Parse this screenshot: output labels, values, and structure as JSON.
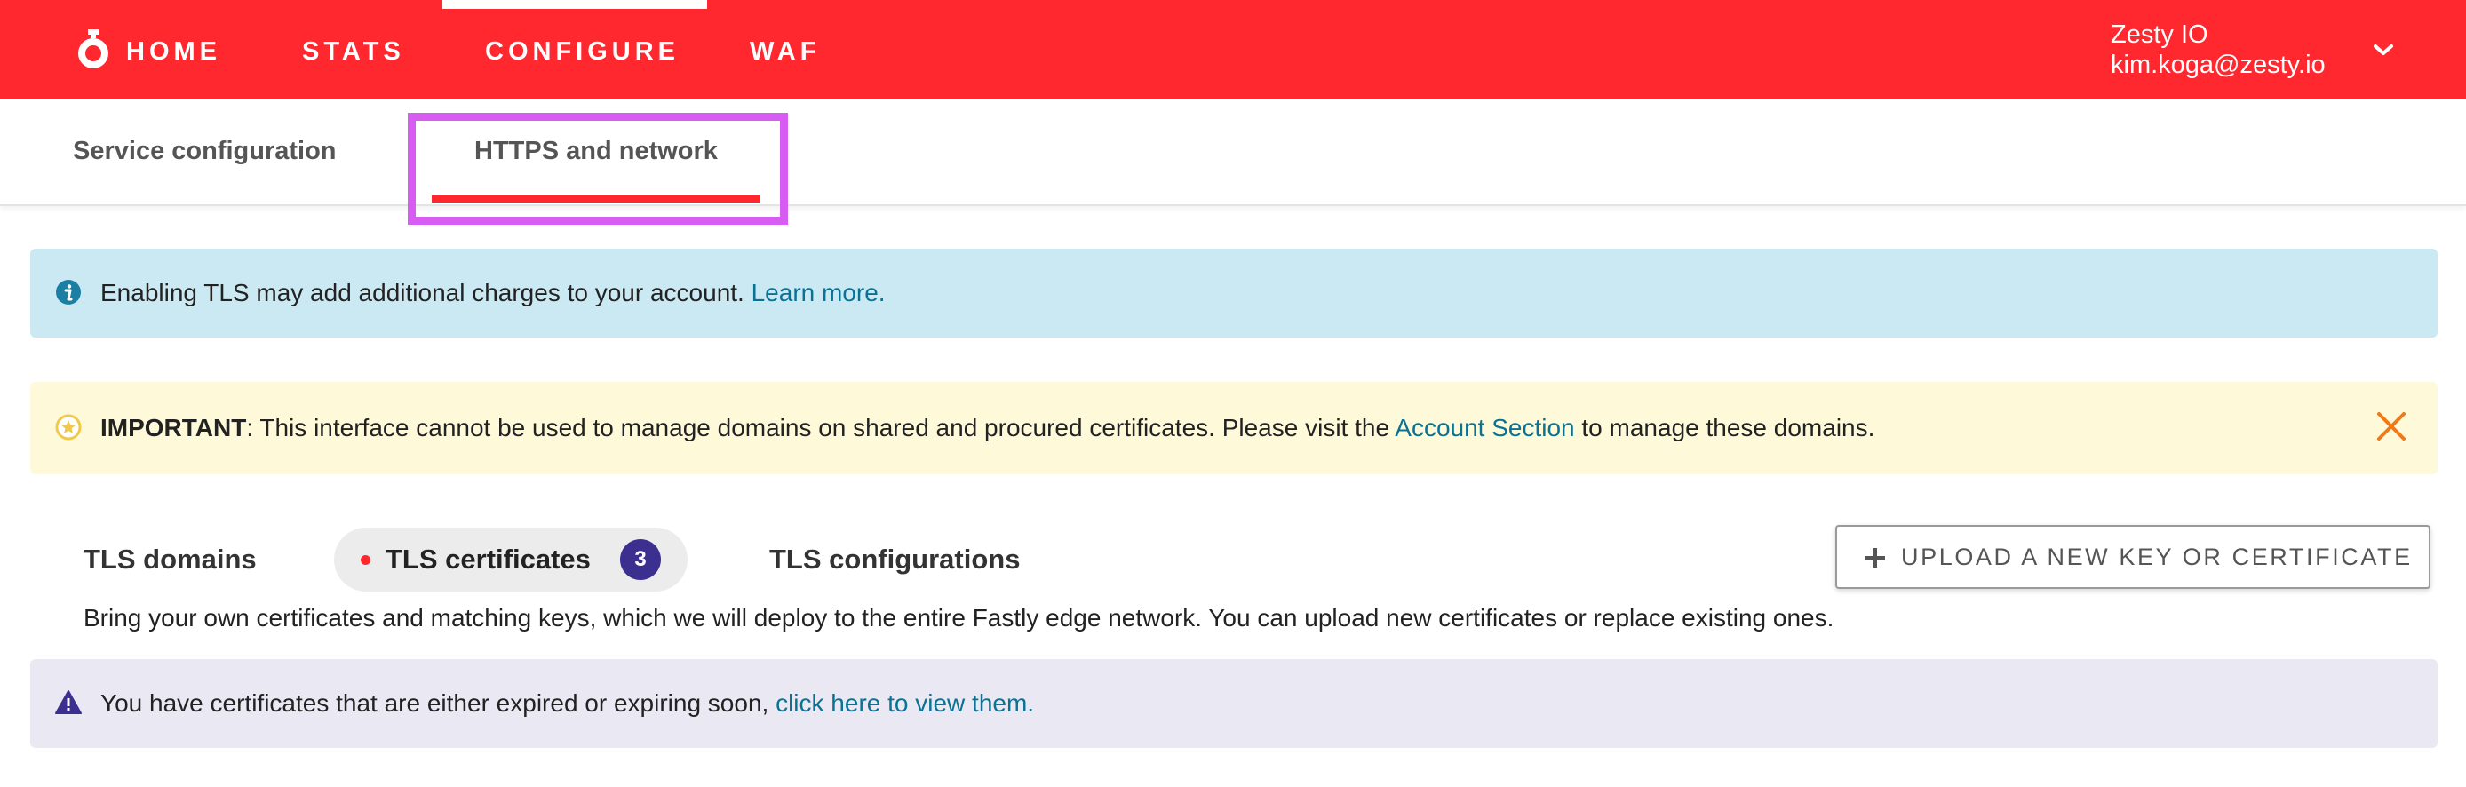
{
  "topnav": {
    "items": [
      {
        "label": "HOME"
      },
      {
        "label": "STATS"
      },
      {
        "label": "CONFIGURE"
      },
      {
        "label": "WAF"
      }
    ],
    "active": "CONFIGURE",
    "account": {
      "name": "Zesty IO",
      "email": "kim.koga@zesty.io"
    }
  },
  "subtabs": {
    "items": [
      {
        "label": "Service configuration"
      },
      {
        "label": "HTTPS and network"
      }
    ],
    "active": "HTTPS and network"
  },
  "alerts": {
    "info": {
      "text": "Enabling TLS may add additional charges to your account.",
      "link": "Learn more."
    },
    "important": {
      "label": "IMPORTANT",
      "text": ": This interface cannot be used to manage domains on shared and procured certificates. Please visit the",
      "link": "Account Section",
      "suffix": "to manage these domains."
    },
    "warning": {
      "text": "You have certificates that are either expired or expiring soon,",
      "link": "click here to view them."
    }
  },
  "tls": {
    "tabs": [
      {
        "label": "TLS domains"
      },
      {
        "label": "TLS certificates",
        "count": "3"
      },
      {
        "label": "TLS configurations"
      }
    ],
    "active": "TLS certificates",
    "upload_label": "UPLOAD A NEW KEY OR CERTIFICATE",
    "description": "Bring your own certificates and matching keys, which we will deploy to the entire Fastly edge network. You can upload new certificates or replace existing ones."
  },
  "colors": {
    "brand_red": "#ff282f",
    "highlight": "#d65cf2",
    "info_bg": "#cbe9f3",
    "important_bg": "#fef9d9",
    "warn_bg": "#e9e8f3",
    "badge": "#3b2f8f",
    "link": "#0a7293"
  },
  "icons": {
    "logo": "stopwatch-logo-icon",
    "account_menu": "chevron-down-icon",
    "info": "info-circle-icon",
    "important": "star-circle-icon",
    "close": "close-icon",
    "warning": "warning-triangle-icon",
    "upload": "plus-icon"
  }
}
